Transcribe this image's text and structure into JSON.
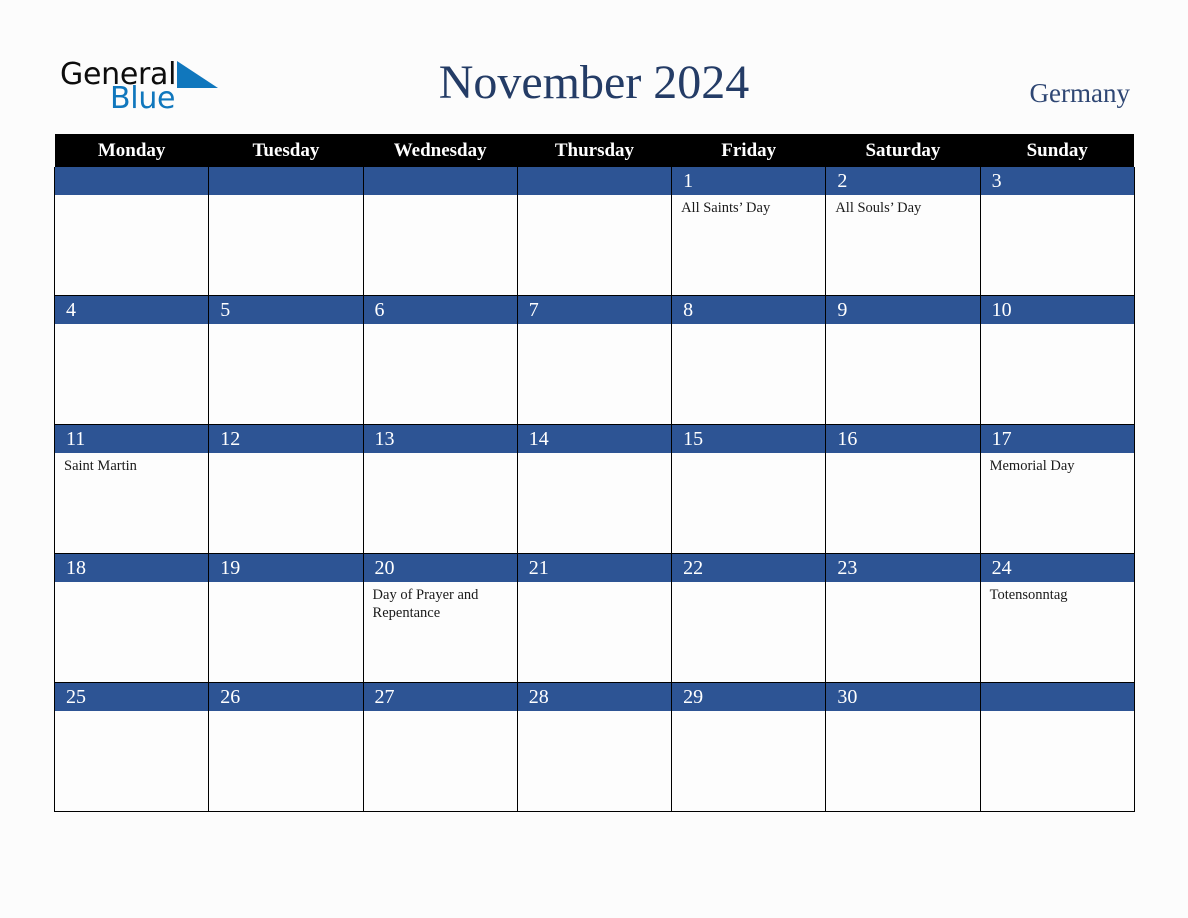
{
  "brand": {
    "name_part1": "General",
    "name_part2": "Blue",
    "triangle_icon": "triangle-icon",
    "triangle_color": "#1077bd"
  },
  "header": {
    "title": "November 2024",
    "country": "Germany"
  },
  "colors": {
    "page_background": "#fcfcfc",
    "weekday_header_bg": "#000000",
    "weekday_header_text": "#ffffff",
    "day_band_bg": "#2d5494",
    "day_band_text": "#ffffff",
    "title_text": "#243c66",
    "country_text": "#2e4673",
    "cell_border": "#000000",
    "cell_bg": "#fdfdfd",
    "holiday_text": "#1a1a1a",
    "brand_black": "#0d0d0d",
    "brand_blue": "#1077bd"
  },
  "calendar": {
    "weekdays": [
      "Monday",
      "Tuesday",
      "Wednesday",
      "Thursday",
      "Friday",
      "Saturday",
      "Sunday"
    ],
    "weeks": [
      [
        {
          "day": "",
          "events": []
        },
        {
          "day": "",
          "events": []
        },
        {
          "day": "",
          "events": []
        },
        {
          "day": "",
          "events": []
        },
        {
          "day": "1",
          "events": [
            "All Saints’ Day"
          ]
        },
        {
          "day": "2",
          "events": [
            "All Souls’ Day"
          ]
        },
        {
          "day": "3",
          "events": []
        }
      ],
      [
        {
          "day": "4",
          "events": []
        },
        {
          "day": "5",
          "events": []
        },
        {
          "day": "6",
          "events": []
        },
        {
          "day": "7",
          "events": []
        },
        {
          "day": "8",
          "events": []
        },
        {
          "day": "9",
          "events": []
        },
        {
          "day": "10",
          "events": []
        }
      ],
      [
        {
          "day": "11",
          "events": [
            "Saint Martin"
          ]
        },
        {
          "day": "12",
          "events": []
        },
        {
          "day": "13",
          "events": []
        },
        {
          "day": "14",
          "events": []
        },
        {
          "day": "15",
          "events": []
        },
        {
          "day": "16",
          "events": []
        },
        {
          "day": "17",
          "events": [
            "Memorial Day"
          ]
        }
      ],
      [
        {
          "day": "18",
          "events": []
        },
        {
          "day": "19",
          "events": []
        },
        {
          "day": "20",
          "events": [
            "Day of Prayer and Repentance"
          ]
        },
        {
          "day": "21",
          "events": []
        },
        {
          "day": "22",
          "events": []
        },
        {
          "day": "23",
          "events": []
        },
        {
          "day": "24",
          "events": [
            "Totensonntag"
          ]
        }
      ],
      [
        {
          "day": "25",
          "events": []
        },
        {
          "day": "26",
          "events": []
        },
        {
          "day": "27",
          "events": []
        },
        {
          "day": "28",
          "events": []
        },
        {
          "day": "29",
          "events": []
        },
        {
          "day": "30",
          "events": []
        },
        {
          "day": "",
          "events": []
        }
      ]
    ]
  }
}
